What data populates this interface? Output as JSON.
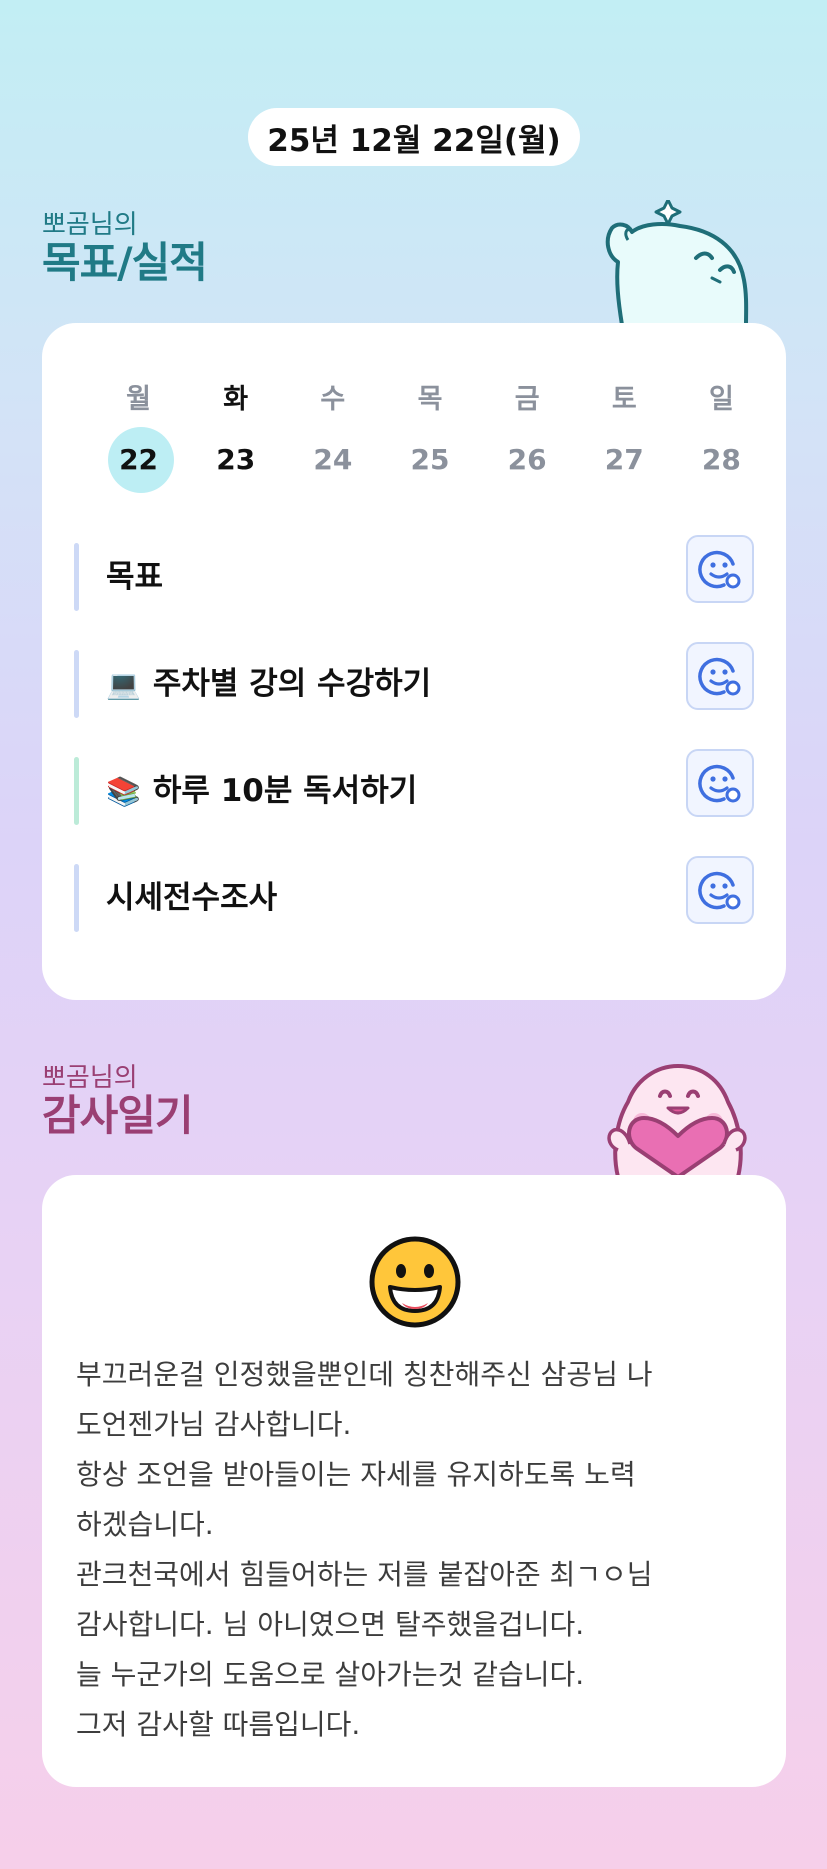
{
  "date_label": "25년 12월 22일(월)",
  "goal_section": {
    "subtitle": "뽀곰님의",
    "title": "목표/실적"
  },
  "week": [
    {
      "day": "월",
      "date": "22"
    },
    {
      "day": "화",
      "date": "23"
    },
    {
      "day": "수",
      "date": "24"
    },
    {
      "day": "목",
      "date": "25"
    },
    {
      "day": "금",
      "date": "26"
    },
    {
      "day": "토",
      "date": "27"
    },
    {
      "day": "일",
      "date": "28"
    }
  ],
  "goals": [
    {
      "emoji": "",
      "label": "목표"
    },
    {
      "emoji": "💻",
      "label": "주차별 강의 수강하기"
    },
    {
      "emoji": "📚",
      "label": "하루 10분 독서하기"
    },
    {
      "emoji": "",
      "label": "시세전수조사"
    }
  ],
  "diary_section": {
    "subtitle": "뽀곰님의",
    "title": "감사일기"
  },
  "diary": {
    "mood_icon": "grinning-face-icon",
    "text": "부끄러운걸 인정했을뿐인데 칭찬해주신 삼공님 나\n도언젠가님 감사합니다.\n항상 조언을 받아들이는 자세를 유지하도록 노력\n하겠습니다.\n관크천국에서 힘들어하는 저를 붙잡아준 최ㄱㅇ님\n감사합니다. 님 아니였으면 탈주했을겁니다.\n늘 누군가의 도움으로 살아가는것 같습니다.\n그저 감사할 따름입니다."
  },
  "colors": {
    "goal_title": "#207a86",
    "diary_title": "#9a3f73",
    "today_circle": "#bdeef4",
    "smiley_accent": "#3f6fe0"
  }
}
